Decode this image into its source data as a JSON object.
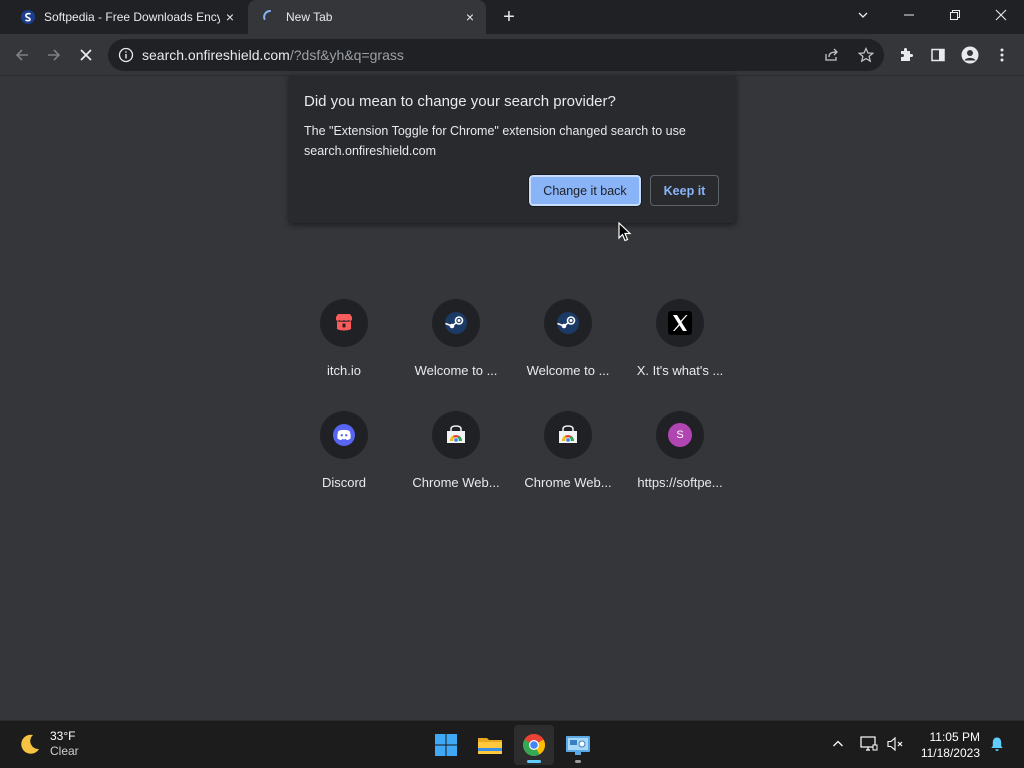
{
  "browser": {
    "tabs": [
      {
        "title": "Softpedia - Free Downloads Encyclopedia",
        "icon": "softpedia-icon",
        "active": false
      },
      {
        "title": "New Tab",
        "icon": "loading-spinner-icon",
        "active": true
      }
    ],
    "new_tab_symbol": "+",
    "close_symbol": "×"
  },
  "toolbar": {
    "url_host": "search.onfireshield.com",
    "url_path": "/?dsf&yh&q=grass"
  },
  "popup": {
    "title": "Did you mean to change your search provider?",
    "message": "The \"Extension Toggle for Chrome\" extension changed search to use search.onfireshield.com",
    "primary_button": "Change it back",
    "secondary_button": "Keep it"
  },
  "shortcuts": [
    {
      "label": "itch.io",
      "icon": "itch-io-icon"
    },
    {
      "label": "Welcome to ...",
      "icon": "steam-icon"
    },
    {
      "label": "Welcome to ...",
      "icon": "steam-icon"
    },
    {
      "label": "X. It's what's ...",
      "icon": "x-icon"
    },
    {
      "label": "Discord",
      "icon": "discord-icon"
    },
    {
      "label": "Chrome Web...",
      "icon": "chrome-web-store-icon"
    },
    {
      "label": "Chrome Web...",
      "icon": "chrome-web-store-icon"
    },
    {
      "label": "https://softpe...",
      "icon": "letter-s-icon",
      "letter": "S"
    }
  ],
  "taskbar": {
    "weather_temp": "33°F",
    "weather_desc": "Clear",
    "time": "11:05 PM",
    "date": "11/18/2023"
  },
  "colors": {
    "accent": "#8ab4f8",
    "background": "#35363a",
    "frame": "#202124"
  }
}
